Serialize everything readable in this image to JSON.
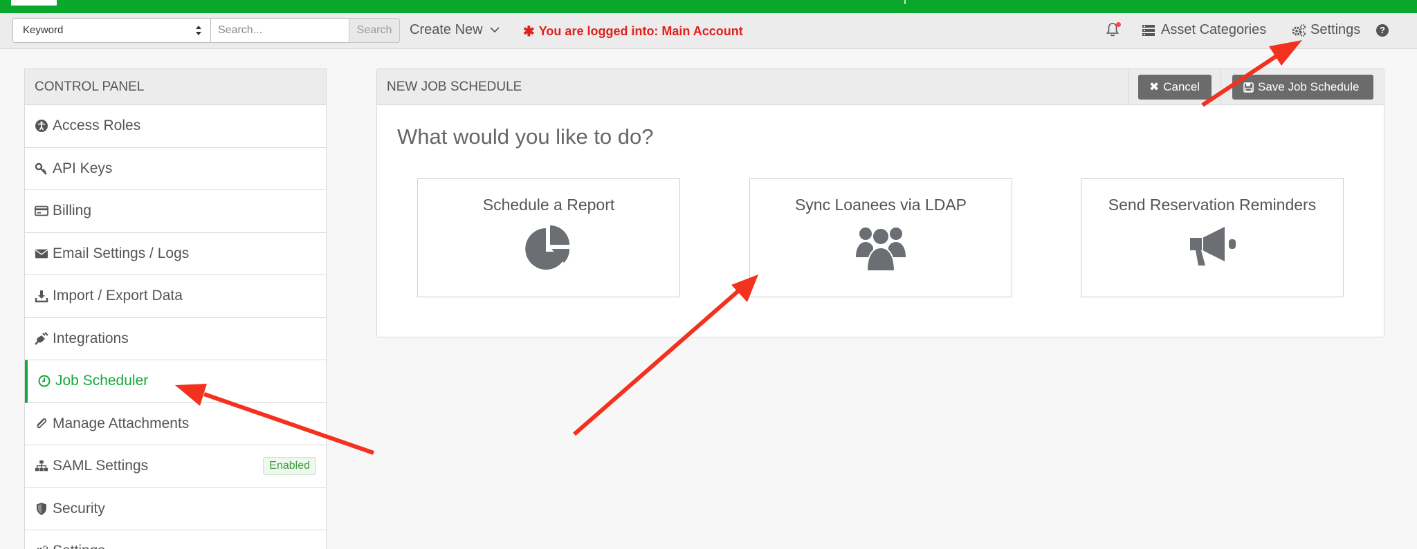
{
  "toolbar": {
    "keyword_select": "Keyword",
    "search_placeholder": "Search...",
    "search_button": "Search",
    "create_new": "Create New",
    "logged_in_message": "You are logged into: Main Account",
    "asset_categories": "Asset Categories",
    "settings": "Settings",
    "help": "?"
  },
  "sidebar": {
    "header": "CONTROL PANEL",
    "items": [
      {
        "label": "Access Roles",
        "icon": "accessibility-icon"
      },
      {
        "label": "API Keys",
        "icon": "key-icon"
      },
      {
        "label": "Billing",
        "icon": "credit-card-icon"
      },
      {
        "label": "Email Settings / Logs",
        "icon": "envelope-icon"
      },
      {
        "label": "Import / Export Data",
        "icon": "download-icon"
      },
      {
        "label": "Integrations",
        "icon": "plug-icon"
      },
      {
        "label": "Job Scheduler",
        "icon": "clock-icon",
        "active": true
      },
      {
        "label": "Manage Attachments",
        "icon": "paperclip-icon"
      },
      {
        "label": "SAML Settings",
        "icon": "sitemap-icon",
        "badge": "Enabled"
      },
      {
        "label": "Security",
        "icon": "shield-icon"
      },
      {
        "label": "Settings",
        "icon": "gears-icon"
      }
    ]
  },
  "panel": {
    "title": "NEW JOB SCHEDULE",
    "cancel": "Cancel",
    "save": "Save Job Schedule",
    "question": "What would you like to do?",
    "options": [
      {
        "label": "Schedule a Report",
        "icon": "pie-chart-icon"
      },
      {
        "label": "Sync Loanees via LDAP",
        "icon": "users-icon"
      },
      {
        "label": "Send Reservation Reminders",
        "icon": "megaphone-icon"
      }
    ]
  },
  "colors": {
    "brand_green": "#0aa82a",
    "active_green": "#14a83b",
    "alert_red": "#e0201b",
    "annotation_arrow": "#f2321e"
  }
}
